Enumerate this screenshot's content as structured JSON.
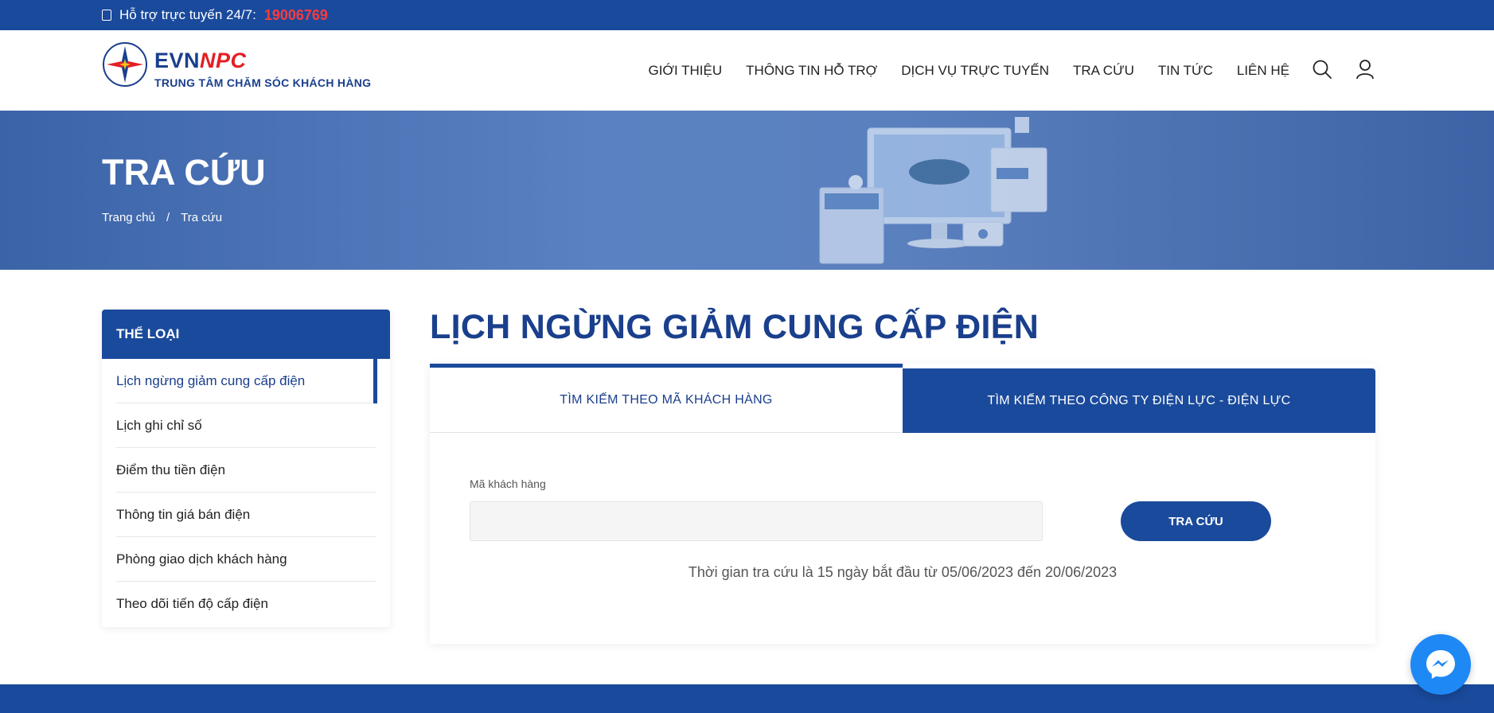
{
  "topbar": {
    "support_label": "Hỗ trợ trực tuyến 24/7:",
    "hotline": "19006769"
  },
  "header": {
    "brand_evn": "EVN",
    "brand_npc": "NPC",
    "tagline": "TRUNG TÂM CHĂM SÓC KHÁCH HÀNG",
    "nav": [
      "GIỚI THIỆU",
      "THÔNG TIN HỖ TRỢ",
      "DỊCH VỤ TRỰC TUYẾN",
      "TRA CỨU",
      "TIN TỨC",
      "LIÊN HỆ"
    ],
    "icons": [
      "search-icon",
      "user-icon"
    ]
  },
  "banner": {
    "title": "TRA CỨU",
    "breadcrumb": [
      "Trang chủ",
      "/",
      "Tra cứu"
    ]
  },
  "sidebar": {
    "heading": "THỂ LOẠI",
    "items": [
      "Lịch ngừng giảm cung cấp điện",
      "Lịch ghi chỉ số",
      "Điểm thu tiền điện",
      "Thông tin giá bán điện",
      "Phòng giao dịch khách hàng",
      "Theo dõi tiến độ cấp điện"
    ],
    "active_index": 0
  },
  "main": {
    "title": "LỊCH NGỪNG GIẢM CUNG CẤP ĐIỆN",
    "tabs": [
      "TÌM KIẾM THEO MÃ KHÁCH HÀNG",
      "TÌM KIẾM THEO CÔNG TY ĐIỆN LỰC - ĐIỆN LỰC"
    ],
    "field_label": "Mã khách hàng",
    "field_value": "",
    "search_button": "TRA CỨU",
    "note": "Thời gian tra cứu là 15 ngày bắt đầu từ 05/06/2023 đến 20/06/2023"
  },
  "colors": {
    "primary": "#1a4a9c",
    "accent_red": "#e31e24",
    "hotline": "#ff3b3b",
    "messenger": "#1e88f5"
  }
}
